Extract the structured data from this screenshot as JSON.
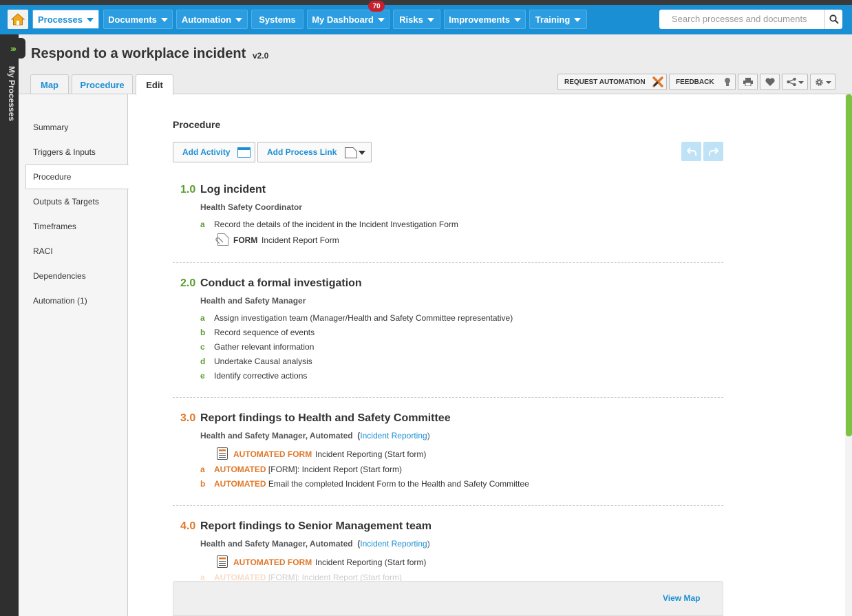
{
  "nav": {
    "items": [
      "Processes",
      "Documents",
      "Automation",
      "Systems",
      "My Dashboard",
      "Risks",
      "Improvements",
      "Training"
    ],
    "badge": "70",
    "search_placeholder": "Search processes and documents"
  },
  "sidebar": {
    "label": "My Processes"
  },
  "page": {
    "title": "Respond to a workplace incident",
    "version": "v2.0"
  },
  "tabs": [
    "Map",
    "Procedure",
    "Edit"
  ],
  "toolbar": {
    "request_automation": "REQUEST AUTOMATION",
    "feedback": "FEEDBACK"
  },
  "left_nav": [
    "Summary",
    "Triggers & Inputs",
    "Procedure",
    "Outputs & Targets",
    "Timeframes",
    "RACI",
    "Dependencies",
    "Automation (1)"
  ],
  "procedure": {
    "heading": "Procedure",
    "add_activity": "Add Activity",
    "add_process_link": "Add Process Link",
    "view_map": "View Map"
  },
  "steps": [
    {
      "num": "1.0",
      "title": "Log incident",
      "role": "Health Safety Coordinator",
      "subs": [
        {
          "letter": "a",
          "text": "Record the details of the incident in the Incident Investigation Form"
        }
      ],
      "resource": {
        "type": "FORM",
        "name": "Incident Report Form"
      }
    },
    {
      "num": "2.0",
      "title": "Conduct a formal investigation",
      "role": "Health and Safety Manager",
      "subs": [
        {
          "letter": "a",
          "text": "Assign investigation team (Manager/Health and Safety Committee representative)"
        },
        {
          "letter": "b",
          "text": "Record sequence of events"
        },
        {
          "letter": "c",
          "text": "Gather relevant information"
        },
        {
          "letter": "d",
          "text": "Undertake Causal analysis"
        },
        {
          "letter": "e",
          "text": "Identify corrective actions"
        }
      ]
    },
    {
      "num": "3.0",
      "title": "Report findings to Health and Safety Committee",
      "role": "Health and Safety Manager,  Automated",
      "role_link": "Incident Reporting",
      "resource": {
        "type": "AUTOMATED FORM",
        "name": "Incident Reporting (Start form)"
      },
      "subs": [
        {
          "letter": "a",
          "tag": "AUTOMATED",
          "text": "[FORM]: Incident Report (Start form)"
        },
        {
          "letter": "b",
          "tag": "AUTOMATED",
          "text": "Email the completed Incident Form to the Health and Safety Committee"
        }
      ]
    },
    {
      "num": "4.0",
      "title": "Report findings to Senior Management team",
      "role": "Health and Safety Manager,  Automated",
      "role_link": "Incident Reporting",
      "resource": {
        "type": "AUTOMATED FORM",
        "name": "Incident Reporting (Start form)"
      },
      "subs": [
        {
          "letter": "a",
          "tag": "AUTOMATED",
          "text": "[FORM]: Incident Report (Start form)"
        }
      ]
    }
  ],
  "colors": {
    "brand_blue": "#1b8fd4",
    "green": "#5a9e2f",
    "orange": "#e0782a",
    "badge_red": "#c8202e"
  }
}
